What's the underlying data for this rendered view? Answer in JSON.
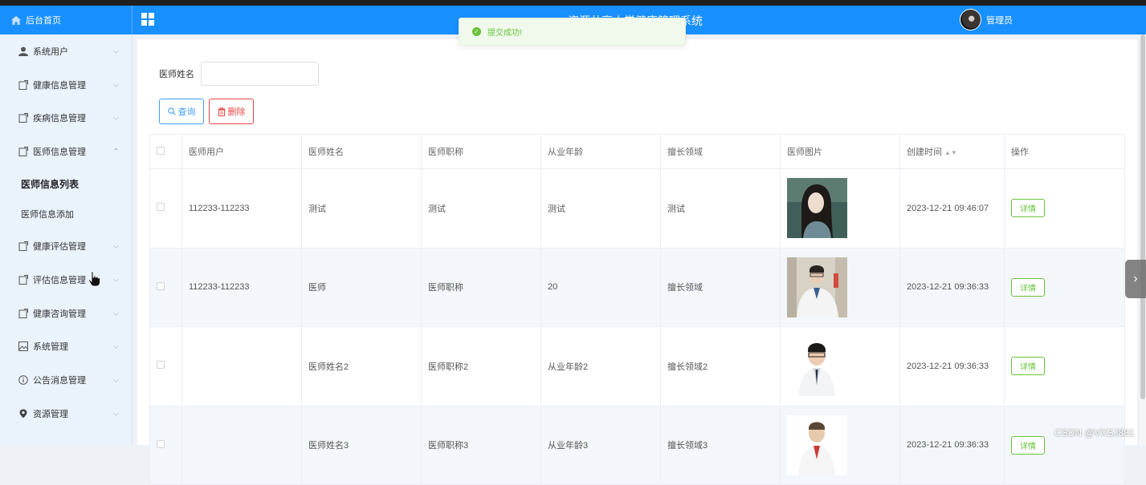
{
  "header": {
    "home_label": "后台首页",
    "app_title": "资源共享大学健康管理系统",
    "user_name": "管理员"
  },
  "sidebar": {
    "items": [
      {
        "label": "系统用户",
        "icon": "user-icon"
      },
      {
        "label": "健康信息管理",
        "icon": "doc-icon"
      },
      {
        "label": "疾病信息管理",
        "icon": "doc-icon"
      },
      {
        "label": "医师信息管理",
        "icon": "doc-icon"
      },
      {
        "label": "健康评估管理",
        "icon": "doc-icon"
      },
      {
        "label": "评估信息管理",
        "icon": "doc-icon"
      },
      {
        "label": "健康咨询管理",
        "icon": "doc-icon"
      },
      {
        "label": "系统管理",
        "icon": "picture-icon"
      },
      {
        "label": "公告消息管理",
        "icon": "info-icon"
      },
      {
        "label": "资源管理",
        "icon": "location-icon"
      }
    ],
    "sub_items": [
      "医师信息列表",
      "医师信息添加"
    ]
  },
  "search": {
    "label": "医师姓名",
    "value": "",
    "query_label": "查询",
    "delete_label": "删除"
  },
  "table": {
    "headers": [
      "医师用户",
      "医师姓名",
      "医师职称",
      "从业年龄",
      "擅长领域",
      "医师图片",
      "创建时间",
      "操作"
    ],
    "rows": [
      {
        "user": "112233-112233",
        "name": "测试",
        "title": "测试",
        "years": "测试",
        "field": "测试",
        "created": "2023-12-21 09:46:07",
        "action": "详情"
      },
      {
        "user": "112233-112233",
        "name": "医师",
        "title": "医师职称",
        "years": "20",
        "field": "擅长领域",
        "created": "2023-12-21 09:36:33",
        "action": "详情"
      },
      {
        "user": "",
        "name": "医师姓名2",
        "title": "医师职称2",
        "years": "从业年龄2",
        "field": "擅长领域2",
        "created": "2023-12-21 09:36:33",
        "action": "详情"
      },
      {
        "user": "",
        "name": "医师姓名3",
        "title": "医师职称3",
        "years": "从业年龄3",
        "field": "擅长领域3",
        "created": "2023-12-21 09:36:33",
        "action": "详情"
      }
    ]
  },
  "toast": {
    "message": "提交成功!"
  },
  "watermark": "CSDN @VXSJ881",
  "colors": {
    "primary": "#1890ff",
    "success": "#67c23a",
    "danger": "#e64545",
    "sidebar_bg": "#eaf2fb"
  }
}
